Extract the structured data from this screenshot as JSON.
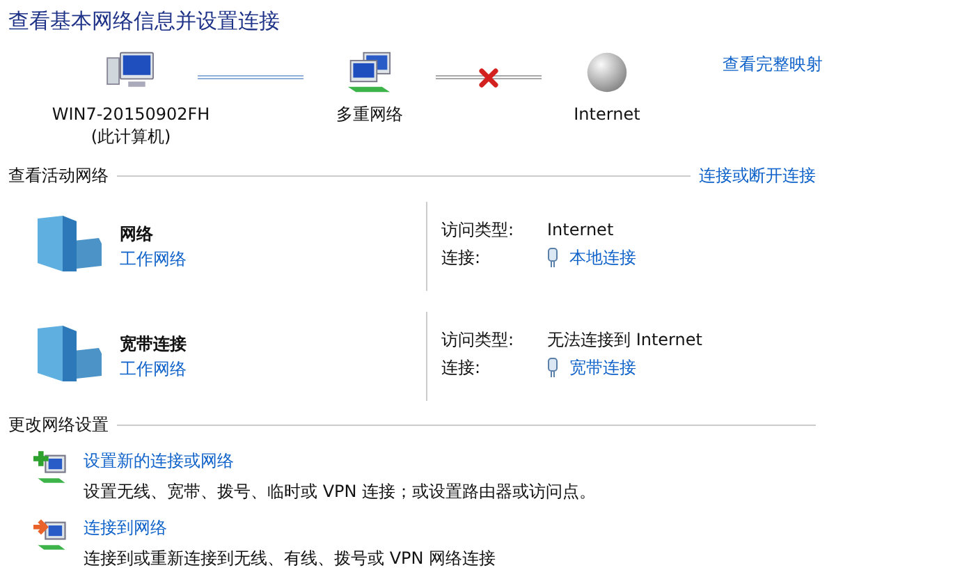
{
  "title": "查看基本网络信息并设置连接",
  "map": {
    "nodes": [
      {
        "kind": "computer",
        "label": "WIN7-20150902FH",
        "sublabel": "(此计算机)"
      },
      {
        "kind": "network",
        "label": "多重网络"
      },
      {
        "kind": "internet",
        "label": "Internet"
      }
    ],
    "links": [
      {
        "broken": false
      },
      {
        "broken": true
      }
    ],
    "full_map_link": "查看完整映射"
  },
  "active_networks": {
    "heading": "查看活动网络",
    "link": "连接或断开连接",
    "items": [
      {
        "name": "网络",
        "category": "工作网络",
        "access_label": "访问类型:",
        "access": "Internet",
        "connection_label": "连接:",
        "connection": "本地连接"
      },
      {
        "name": "宽带连接",
        "category": "工作网络",
        "access_label": "访问类型:",
        "access": "无法连接到 Internet",
        "connection_label": "连接:",
        "connection": "宽带连接"
      }
    ]
  },
  "settings": {
    "heading": "更改网络设置",
    "tasks": [
      {
        "kind": "new",
        "title": "设置新的连接或网络",
        "description": "设置无线、宽带、拨号、临时或 VPN 连接；或设置路由器或访问点。"
      },
      {
        "kind": "connect",
        "title": "连接到网络",
        "description": "连接到或重新连接到无线、有线、拨号或 VPN 网络连接"
      }
    ]
  }
}
